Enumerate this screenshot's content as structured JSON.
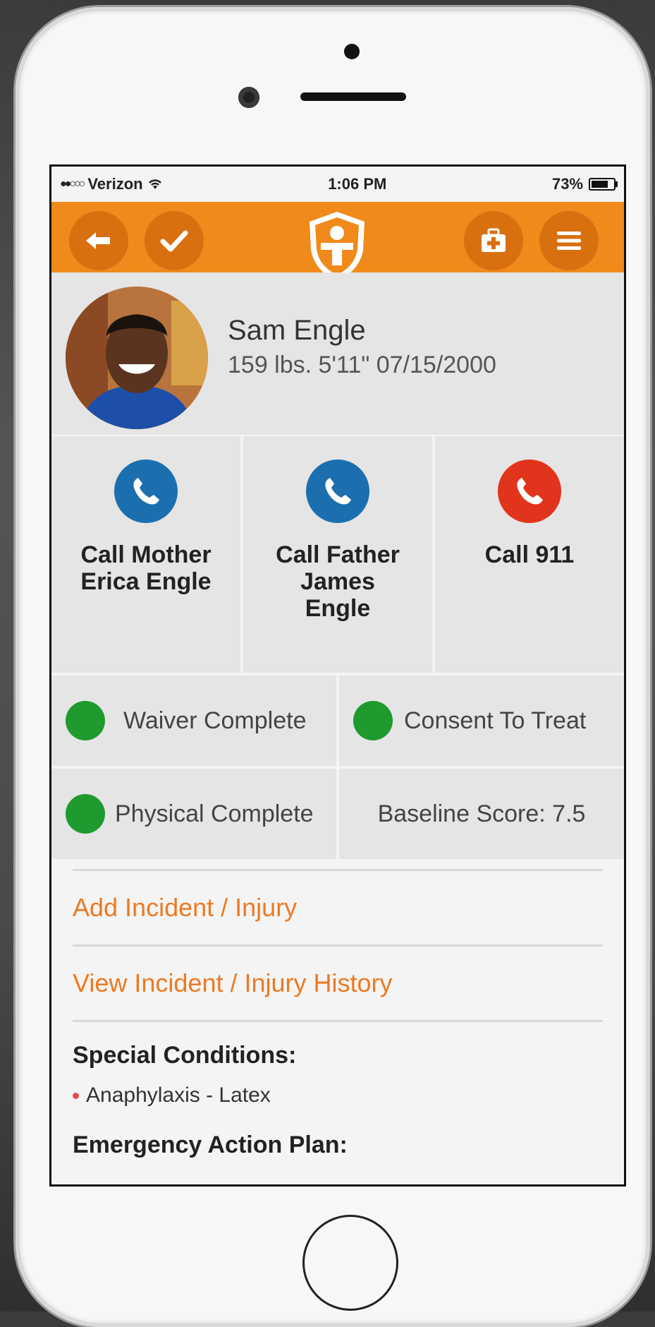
{
  "status": {
    "carrier": "Verizon",
    "signal_dots": "●●○○○",
    "time": "1:06 PM",
    "battery": "73%"
  },
  "navbar": {
    "back_icon": "back-arrow-icon",
    "check_icon": "checkmark-icon",
    "logo_icon": "shield-person-logo-icon",
    "firstaid_icon": "first-aid-kit-icon",
    "menu_icon": "hamburger-menu-icon",
    "accent": "#f08a1a"
  },
  "profile": {
    "name": "Sam Engle",
    "stats": "159 lbs. 5'11\" 07/15/2000"
  },
  "calls": [
    {
      "label": "Call Mother Erica Engle",
      "color": "#1c6fae"
    },
    {
      "label": "Call Father James Engle",
      "color": "#1c6fae"
    },
    {
      "label": "Call 911",
      "color": "#e2341d"
    }
  ],
  "checks": {
    "waiver": "Waiver Complete",
    "consent": "Consent To Treat",
    "physical": "Physical Complete",
    "baseline": "Baseline Score: 7.5",
    "status_color": "#1e9a2e"
  },
  "links": {
    "add_incident": "Add Incident / Injury",
    "view_history": "View Incident / Injury History"
  },
  "conditions": {
    "title": "Special Conditions:",
    "items": [
      "Anaphylaxis - Latex"
    ]
  },
  "emergency_plan": {
    "title": "Emergency Action Plan:"
  }
}
